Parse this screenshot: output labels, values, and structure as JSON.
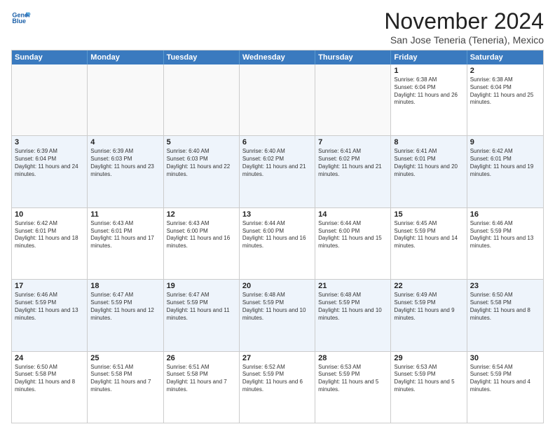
{
  "logo": {
    "line1": "General",
    "line2": "Blue"
  },
  "title": "November 2024",
  "subtitle": "San Jose Teneria (Teneria), Mexico",
  "weekdays": [
    "Sunday",
    "Monday",
    "Tuesday",
    "Wednesday",
    "Thursday",
    "Friday",
    "Saturday"
  ],
  "rows": [
    [
      {
        "day": "",
        "text": "",
        "empty": true
      },
      {
        "day": "",
        "text": "",
        "empty": true
      },
      {
        "day": "",
        "text": "",
        "empty": true
      },
      {
        "day": "",
        "text": "",
        "empty": true
      },
      {
        "day": "",
        "text": "",
        "empty": true
      },
      {
        "day": "1",
        "text": "Sunrise: 6:38 AM\nSunset: 6:04 PM\nDaylight: 11 hours and 26 minutes."
      },
      {
        "day": "2",
        "text": "Sunrise: 6:38 AM\nSunset: 6:04 PM\nDaylight: 11 hours and 25 minutes."
      }
    ],
    [
      {
        "day": "3",
        "text": "Sunrise: 6:39 AM\nSunset: 6:04 PM\nDaylight: 11 hours and 24 minutes."
      },
      {
        "day": "4",
        "text": "Sunrise: 6:39 AM\nSunset: 6:03 PM\nDaylight: 11 hours and 23 minutes."
      },
      {
        "day": "5",
        "text": "Sunrise: 6:40 AM\nSunset: 6:03 PM\nDaylight: 11 hours and 22 minutes."
      },
      {
        "day": "6",
        "text": "Sunrise: 6:40 AM\nSunset: 6:02 PM\nDaylight: 11 hours and 21 minutes."
      },
      {
        "day": "7",
        "text": "Sunrise: 6:41 AM\nSunset: 6:02 PM\nDaylight: 11 hours and 21 minutes."
      },
      {
        "day": "8",
        "text": "Sunrise: 6:41 AM\nSunset: 6:01 PM\nDaylight: 11 hours and 20 minutes."
      },
      {
        "day": "9",
        "text": "Sunrise: 6:42 AM\nSunset: 6:01 PM\nDaylight: 11 hours and 19 minutes."
      }
    ],
    [
      {
        "day": "10",
        "text": "Sunrise: 6:42 AM\nSunset: 6:01 PM\nDaylight: 11 hours and 18 minutes."
      },
      {
        "day": "11",
        "text": "Sunrise: 6:43 AM\nSunset: 6:01 PM\nDaylight: 11 hours and 17 minutes."
      },
      {
        "day": "12",
        "text": "Sunrise: 6:43 AM\nSunset: 6:00 PM\nDaylight: 11 hours and 16 minutes."
      },
      {
        "day": "13",
        "text": "Sunrise: 6:44 AM\nSunset: 6:00 PM\nDaylight: 11 hours and 16 minutes."
      },
      {
        "day": "14",
        "text": "Sunrise: 6:44 AM\nSunset: 6:00 PM\nDaylight: 11 hours and 15 minutes."
      },
      {
        "day": "15",
        "text": "Sunrise: 6:45 AM\nSunset: 5:59 PM\nDaylight: 11 hours and 14 minutes."
      },
      {
        "day": "16",
        "text": "Sunrise: 6:46 AM\nSunset: 5:59 PM\nDaylight: 11 hours and 13 minutes."
      }
    ],
    [
      {
        "day": "17",
        "text": "Sunrise: 6:46 AM\nSunset: 5:59 PM\nDaylight: 11 hours and 13 minutes."
      },
      {
        "day": "18",
        "text": "Sunrise: 6:47 AM\nSunset: 5:59 PM\nDaylight: 11 hours and 12 minutes."
      },
      {
        "day": "19",
        "text": "Sunrise: 6:47 AM\nSunset: 5:59 PM\nDaylight: 11 hours and 11 minutes."
      },
      {
        "day": "20",
        "text": "Sunrise: 6:48 AM\nSunset: 5:59 PM\nDaylight: 11 hours and 10 minutes."
      },
      {
        "day": "21",
        "text": "Sunrise: 6:48 AM\nSunset: 5:59 PM\nDaylight: 11 hours and 10 minutes."
      },
      {
        "day": "22",
        "text": "Sunrise: 6:49 AM\nSunset: 5:59 PM\nDaylight: 11 hours and 9 minutes."
      },
      {
        "day": "23",
        "text": "Sunrise: 6:50 AM\nSunset: 5:58 PM\nDaylight: 11 hours and 8 minutes."
      }
    ],
    [
      {
        "day": "24",
        "text": "Sunrise: 6:50 AM\nSunset: 5:58 PM\nDaylight: 11 hours and 8 minutes."
      },
      {
        "day": "25",
        "text": "Sunrise: 6:51 AM\nSunset: 5:58 PM\nDaylight: 11 hours and 7 minutes."
      },
      {
        "day": "26",
        "text": "Sunrise: 6:51 AM\nSunset: 5:58 PM\nDaylight: 11 hours and 7 minutes."
      },
      {
        "day": "27",
        "text": "Sunrise: 6:52 AM\nSunset: 5:59 PM\nDaylight: 11 hours and 6 minutes."
      },
      {
        "day": "28",
        "text": "Sunrise: 6:53 AM\nSunset: 5:59 PM\nDaylight: 11 hours and 5 minutes."
      },
      {
        "day": "29",
        "text": "Sunrise: 6:53 AM\nSunset: 5:59 PM\nDaylight: 11 hours and 5 minutes."
      },
      {
        "day": "30",
        "text": "Sunrise: 6:54 AM\nSunset: 5:59 PM\nDaylight: 11 hours and 4 minutes."
      }
    ]
  ]
}
